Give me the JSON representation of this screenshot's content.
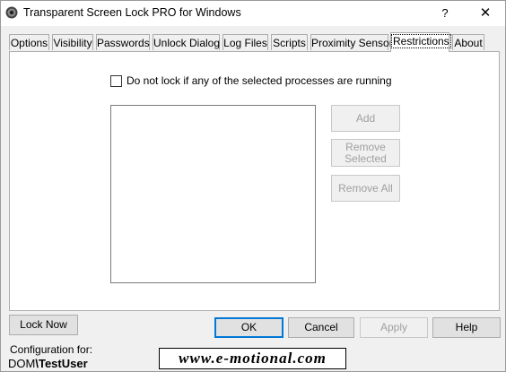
{
  "window": {
    "title": "Transparent Screen Lock PRO for Windows",
    "help_label": "?",
    "close_label": "✕"
  },
  "tabs": [
    {
      "label": "Options"
    },
    {
      "label": "Visibility"
    },
    {
      "label": "Passwords"
    },
    {
      "label": "Unlock Dialog"
    },
    {
      "label": "Log Files"
    },
    {
      "label": "Scripts"
    },
    {
      "label": "Proximity Sensor"
    },
    {
      "label": "Restrictions",
      "active": true
    },
    {
      "label": "About"
    }
  ],
  "restrictions": {
    "checkbox_label": "Do not lock if any of the selected processes are running",
    "checkbox_checked": false,
    "add_label": "Add",
    "remove_selected_line1": "Remove",
    "remove_selected_line2": "Selected",
    "remove_all_label": "Remove All"
  },
  "bottom": {
    "lock_now_label": "Lock Now",
    "ok_label": "OK",
    "cancel_label": "Cancel",
    "apply_label": "Apply",
    "help_label": "Help",
    "config_label": "Configuration for:",
    "config_domain": "DOM",
    "config_user": "TestUser",
    "logo_text": "www.e-motional.com"
  },
  "colors": {
    "accent": "#0078d7",
    "disabled_text": "#a0a0a0"
  }
}
